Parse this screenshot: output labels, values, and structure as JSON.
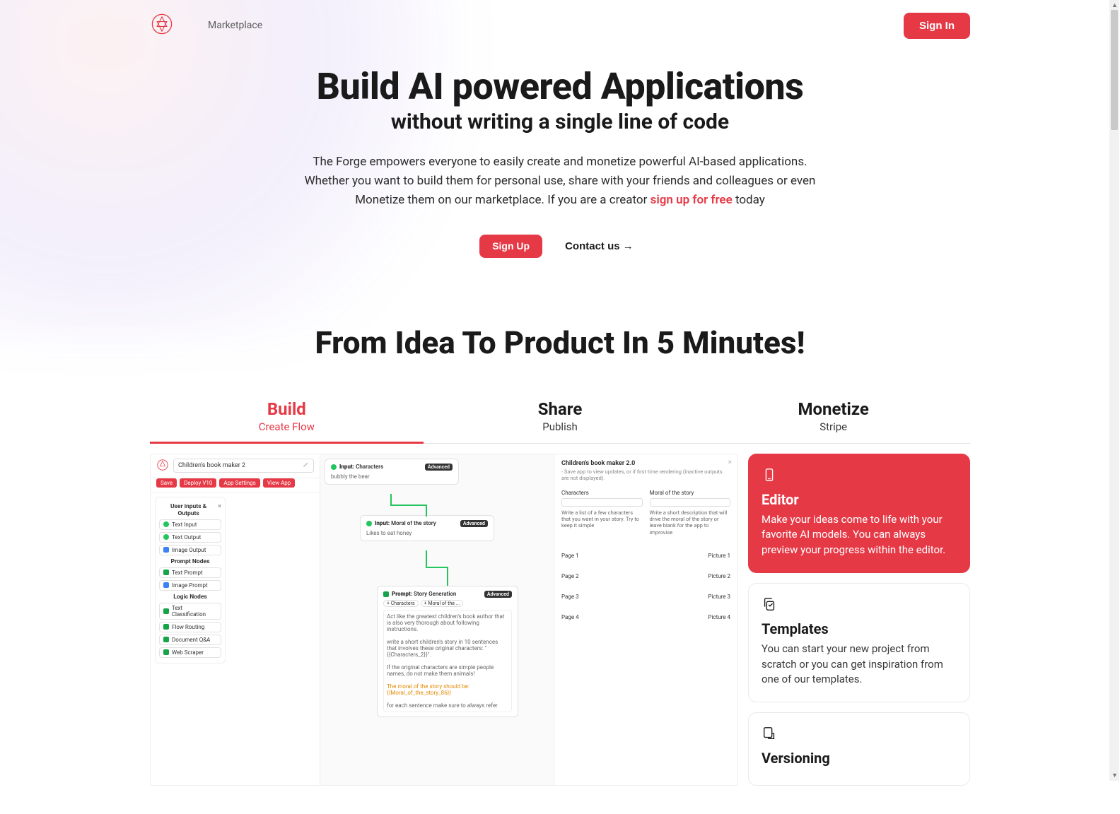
{
  "header": {
    "nav_marketplace": "Marketplace",
    "sign_in": "Sign In"
  },
  "hero": {
    "title": "Build AI powered Applications",
    "subtitle": "without writing a single line of code",
    "desc_pre": "The Forge empowers everyone to easily create and monetize powerful AI-based applications. Whether you want to build them for personal use, share with your friends and colleagues or even Monetize them on our marketplace. If you are a creator ",
    "desc_link": "sign up for free",
    "desc_post": " today",
    "cta_primary": "Sign Up",
    "cta_secondary": "Contact us →"
  },
  "section_title": "From Idea To Product In 5 Minutes!",
  "tabs": [
    {
      "title": "Build",
      "sub": "Create Flow",
      "active": true
    },
    {
      "title": "Share",
      "sub": "Publish",
      "active": false
    },
    {
      "title": "Monetize",
      "sub": "Stripe",
      "active": false
    }
  ],
  "features": [
    {
      "title": "Editor",
      "desc": "Make your ideas come to life with your favorite AI models. You can always preview your progress within the editor.",
      "active": true
    },
    {
      "title": "Templates",
      "desc": "You can start your new project from scratch or you can get inspiration from one of our templates.",
      "active": false
    },
    {
      "title": "Versioning",
      "desc": "",
      "active": false
    }
  ],
  "editor": {
    "app_title": "Children's book maker 2",
    "toolbar": {
      "save": "Save",
      "deploy": "Deploy V10",
      "settings": "App Settings",
      "view": "View App"
    },
    "palette": {
      "group1_title": "User inputs & Outputs",
      "items1": [
        "Text Input",
        "Text Output",
        "Image Output"
      ],
      "group2_title": "Prompt Nodes",
      "items2": [
        "Text Prompt",
        "Image Prompt"
      ],
      "group3_title": "Logic Nodes",
      "items3": [
        "Text Classification",
        "Flow Routing",
        "Document Q&A",
        "Web Scraper"
      ]
    },
    "nodes": {
      "n1": {
        "label": "Input:",
        "name": "Characters",
        "badge": "Advanced",
        "body": "bubbly the bear"
      },
      "n2": {
        "label": "Input:",
        "name": "Moral of the story",
        "badge": "Advanced",
        "body": "Likes to eat honey"
      },
      "n3": {
        "label": "Prompt:",
        "name": "Story Generation",
        "badge": "Advanced",
        "chip1": "+ Characters",
        "chip2": "+ Moral of the ...",
        "body1": "Act like the greatest children's book author that is also very thorough about following instructions.",
        "body2": "write a short children's story in 10 sentences that involves these original characters: \"{{Characters_2}}\".",
        "body3": "If the original characters are simple people names, do not make them animals!",
        "body4": "The moral of the story should be: {{Moral_of_the_story_86}}",
        "body5": "for each sentence make sure to always refer"
      }
    },
    "preview": {
      "title": "Children's book maker 2.0",
      "sub": "- Save app to view updates, or if first time rendering (inactive outputs are not displayed).",
      "field1": {
        "label": "Characters",
        "hint": "Write a list of a few characters that you want in your story. Try to keep it simple"
      },
      "field2": {
        "label": "Moral of the story",
        "hint": "Write a short description that will drive the moral of the story or leave blank for the app to improvise"
      },
      "pages": [
        {
          "l": "Page 1",
          "r": "Picture 1"
        },
        {
          "l": "Page 2",
          "r": "Picture 2"
        },
        {
          "l": "Page 3",
          "r": "Picture 3"
        },
        {
          "l": "Page 4",
          "r": "Picture 4"
        }
      ]
    }
  }
}
